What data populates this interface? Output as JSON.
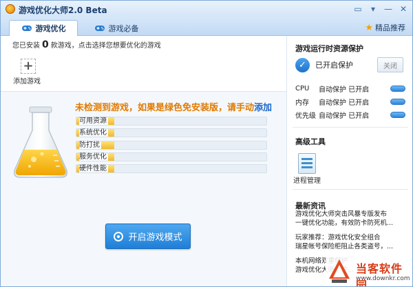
{
  "window": {
    "title": "游戏优化大师2.0 Beta",
    "buttons": {
      "chat": "▭",
      "menu": "▾",
      "minimize": "—",
      "close": "✕"
    }
  },
  "tabs": [
    {
      "label": "游戏优化",
      "active": true
    },
    {
      "label": "游戏必备",
      "active": false
    }
  ],
  "recommend_label": "精品推荐",
  "left": {
    "installed_prefix": "您已安装",
    "installed_count": "0",
    "installed_suffix": "款游戏，点击选择您想要优化的游戏",
    "add_game_label": "添加游戏",
    "not_found_text": "未检测到游戏，如果是绿色免安装版，请手动",
    "not_found_link": "添加",
    "resources": [
      {
        "label": "可用资源",
        "fill": 0.2
      },
      {
        "label": "系统优化",
        "fill": 0.2
      },
      {
        "label": "防打扰",
        "fill": 0.2
      },
      {
        "label": "服务优化",
        "fill": 0.2
      },
      {
        "label": "硬件性能",
        "fill": 0.2
      }
    ],
    "start_button": "开启游戏模式"
  },
  "right": {
    "protect_title": "游戏运行时资源保护",
    "protect_status": "已开启保护",
    "close_button": "关闭",
    "stats": [
      {
        "name": "CPU",
        "status": "自动保护 已开启"
      },
      {
        "name": "内存",
        "status": "自动保护 已开启"
      },
      {
        "name": "优先级",
        "status": "自动保护 已开启"
      }
    ],
    "tools_title": "高级工具",
    "tool_label": "进程管理",
    "news_title": "最新资讯",
    "news": [
      "游戏优化大师突击风暴专版发布",
      "一键优化功能，有效防卡防死机...",
      "玩家推荐：游戏优化安全组合",
      "瑞星帐号保险柜阻止各类盗号，...",
      "本机网络双重保护",
      "游戏优化大师保护..."
    ]
  },
  "watermark": {
    "text": "当客软件园",
    "url": "www.downkr.com"
  },
  "colors": {
    "accent": "#1f7fd6",
    "warning": "#e07a00",
    "link": "#1b66c9",
    "bar": "#f1b82a"
  }
}
